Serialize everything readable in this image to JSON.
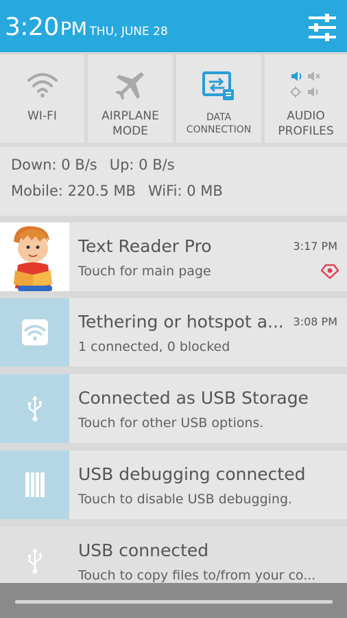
{
  "status": {
    "time": "3:20",
    "ampm": "PM",
    "date": "THU, JUNE 28"
  },
  "toggles": [
    {
      "id": "wifi",
      "label": "WI-FI",
      "icon": "wifi-icon"
    },
    {
      "id": "airplane",
      "label": "AIRPLANE MODE",
      "icon": "airplane-icon"
    },
    {
      "id": "data",
      "label": "DATA CONNECTION",
      "icon": "data-connection-icon"
    },
    {
      "id": "audio",
      "label": "AUDIO PROFILES",
      "icon": "audio-profiles-icon"
    }
  ],
  "stats": {
    "down": "Down: 0 B/s",
    "up": "Up: 0 B/s",
    "mobile": "Mobile: 220.5 MB",
    "wifi": "WiFi: 0 MB"
  },
  "notifications": [
    {
      "title": "Text Reader Pro",
      "subtitle": "Touch for main page",
      "time": "3:17 PM",
      "icon": "text-reader-app-icon"
    },
    {
      "title": "Tethering or hotspot a...",
      "subtitle": "1 connected, 0 blocked",
      "time": "3:08 PM",
      "icon": "hotspot-icon"
    },
    {
      "title": "Connected as USB Storage",
      "subtitle": "Touch for other USB options.",
      "time": "",
      "icon": "usb-icon"
    },
    {
      "title": "USB debugging connected",
      "subtitle": "Touch to disable USB debugging.",
      "time": "",
      "icon": "debug-icon"
    },
    {
      "title": "USB connected",
      "subtitle": "Touch to copy files to/from your co...",
      "time": "",
      "icon": "usb-icon"
    }
  ],
  "colors": {
    "header": "#28a9de",
    "panel": "#e6e6e6",
    "icon_box": "#b5d7e5",
    "accent_blue": "#2a9ed8",
    "badge_red": "#e0435a"
  }
}
